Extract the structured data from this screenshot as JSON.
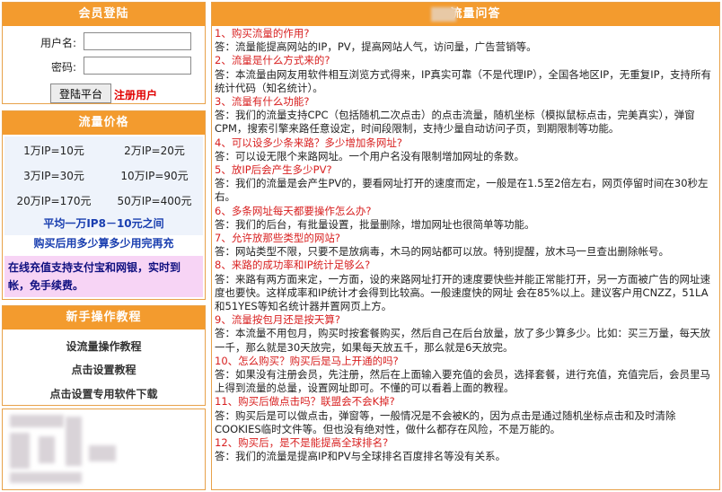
{
  "login": {
    "title": "会员登陆",
    "username_label": "用户名:",
    "password_label": "密码:",
    "username_value": "",
    "password_value": "",
    "submit_label": "登陆平台",
    "register_label": "注册用户"
  },
  "prices": {
    "title": "流量价格",
    "items": [
      {
        "label": "1万IP=10元"
      },
      {
        "label": "2万IP=20元"
      },
      {
        "label": "3万IP=30元"
      },
      {
        "label": "10万IP=90元"
      },
      {
        "label": "20万IP=170元"
      },
      {
        "label": "50万IP=400元"
      }
    ],
    "average": "平均一万IP8－10元之间",
    "buy_note": "购买后用多少算多少用完再充",
    "payment_note": "在线充值支持支付宝和网银，实时到帐，免手续费。"
  },
  "tutorial": {
    "title": "新手操作教程",
    "links": [
      "设流量操作教程",
      "点击设置教程",
      "点击设置专用软件下载"
    ]
  },
  "faq": {
    "title": "流量问答",
    "items": [
      {
        "q": "1、购买流量的作用?",
        "a": "答：流量能提高网站的IP，PV，提高网站人气，访问量，广告营销等。"
      },
      {
        "q": "2、流量是什么方式来的?",
        "a": "答：本流量由网友用软件相互浏览方式得来，IP真实可靠（不是代理IP），全国各地区IP，无重复IP，支持所有统计代码（知名统计）。"
      },
      {
        "q": "3、流量有什么功能?",
        "a": "答：我们的流量支持CPC（包括随机二次点击）的点击流量，随机坐标（模拟鼠标点击，完美真实），弹窗CPM，搜索引擎来路任意设定，时间段限制，支持少量自动访问子页，到期限制等功能。"
      },
      {
        "q": "4、可以设多少条来路？多少增加条网址?",
        "a": "答：可以设无限个来路网址。一个用户名没有限制增加网址的条数。"
      },
      {
        "q": "5、放IP后会产生多少PV?",
        "a": "答：我们的流量是会产生PV的，要看网址打开的速度而定，一般是在1.5至2倍左右，网页停留时间在30秒左右。"
      },
      {
        "q": "6、多条网址每天都要操作怎么办?",
        "a": "答：我们的后台，有批量设置，批量删除，增加网址也很简单等功能。"
      },
      {
        "q": "7、允许放那些类型的网站?",
        "a": "答：网站类型不限，只要不是放病毒，木马的网站都可以放。特别提醒，放木马一旦查出删除帐号。"
      },
      {
        "q": "8、来路的成功率和IP统计足够么?",
        "a": "答：来路有两方面来定，一方面，设的来路网址打开的速度要快些并能正常能打开，另一方面被广告的网址速度也要快。这样成率和IP统计才会得到比较高。一般速度快的网址 会在85%以上。建议客户用CNZZ，51LA和51YES等知名统计器并置网页上方。"
      },
      {
        "q": "9、流量按包月还是按天算?",
        "a": "答：本流量不用包月，购买时按套餐购买，然后自己在后台放量，放了多少算多少。比如：买三万量，每天放一千，那么就是30天放完，如果每天放五千，那么就是6天放完。"
      },
      {
        "q": "10、怎么购买？购买后是马上开通的吗?",
        "a": "答：如果没有注册会员，先注册，然后在上面输入要充值的会员，选择套餐，进行充值，充值完后，会员里马上得到流量的总量，设置网址即可。不懂的可以看着上面的教程。"
      },
      {
        "q": "11、购买后做点击吗？联盟会不会K掉?",
        "a": "答：购买后是可以做点击，弹窗等，一般情况是不会被K的，因为点击是通过随机坐标点击和及时清除COOKIES临时文件等。但也没有绝对性，做什么都存在风险，不是万能的。"
      },
      {
        "q": "12、购买后，是不是能提高全球排名?",
        "a": "答：我们的流量是提高IP和PV与全球排名百度排名等没有关系。"
      }
    ]
  },
  "colors": {
    "header_orange": "#f39b2e",
    "border": "#e8a24a",
    "question_red": "#d82020",
    "price_blue": "#1a3fb0",
    "payment_bg": "#f7d4f5"
  }
}
